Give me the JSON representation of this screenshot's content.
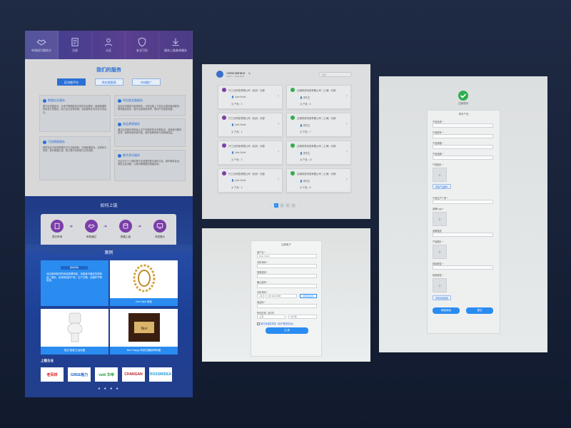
{
  "colors": {
    "accent": "#2a8cf0",
    "brand_purple": "#7b3ea8",
    "success": "#2fae4f",
    "background": "#172238"
  },
  "landing": {
    "nav": [
      {
        "label": "申请成为服务方",
        "icon": "handshake-icon"
      },
      {
        "label": "注册",
        "icon": "document-icon"
      },
      {
        "label": "认证",
        "icon": "user-icon"
      },
      {
        "label": "安全可信",
        "icon": "shield-icon"
      },
      {
        "label": "服务上链查询服务",
        "icon": "download-icon"
      }
    ],
    "services_title": "我们的服务",
    "service_tabs": [
      "区块链平台",
      "供应链管理",
      "市场推广"
    ],
    "service_cards": [
      {
        "title": "数据存证服务",
        "text": "基于区块链技术，为电子数据提供可信的存证服务，确保数据的真实性与完整性，助力企业合规发展，全面保障业务安全可靠运行。"
      },
      {
        "title": "供应链金融服务",
        "text": "结合区块链的可追溯特性，为供应链上下游企业提供融资服务，降低融资成本，提升资金周转效率，推动产业健康发展。"
      },
      {
        "title": "商品溯源服务",
        "text": "通过区块链记录商品从生产到销售的全流程信息，消费者可随时查询，保障商品来源可信，维护品牌形象与消费者权益。"
      },
      {
        "title": "可信数据服务",
        "text": "提供安全可信的数据共享与交换机制，打破数据孤岛，实现多方协同，提升数据价值，助力数字化转型与业务创新。"
      },
      {
        "title": "数字身份服务",
        "text": "为企业与个人提供基于区块链的数字身份认证，保护隐私安全，简化认证流程，让身份管理更加便捷高效。"
      }
    ],
    "how_title": "如何上链",
    "steps": [
      {
        "label": "提交申请",
        "icon": "form-icon"
      },
      {
        "label": "审核通过",
        "icon": "handshake-icon"
      },
      {
        "label": "数据上链",
        "icon": "database-icon"
      },
      {
        "label": "完成展示",
        "icon": "display-icon"
      }
    ],
    "how_button": "我要上链",
    "cases_title": "案例",
    "cases": [
      {
        "label": "",
        "tag": "各地风味",
        "text": "对应各种各样的商品溯源场景，消费者可通过扫描商品二维码，查询商品的产地、生产日期、流通环节等信息。"
      },
      {
        "label": "Gee Mye 珠宝"
      },
      {
        "label": "恒洁 智能卫浴设备"
      },
      {
        "label": "Bee Happy 有机红糖咖啡粉蜜"
      }
    ],
    "cases_highlight_text": "对应各种各样的商品溯源场景，消费者可通过扫描商品二维码，查询商品的产地、生产日期、流通环节等信息。",
    "partners_title": "上链企业",
    "partners": [
      "老凤祥",
      "GREE格力",
      "vatti 华帝",
      "CHANGAN",
      "ROSSMIDEA"
    ],
    "dots": "● ● ● ●"
  },
  "list": {
    "user_name": "Administrator",
    "user_sub": "Admin · 1234 5678",
    "search_placeholder": "搜索",
    "cards": [
      {
        "company": "兴三元科技有限公司（北京）分部",
        "person": "Julie Smith",
        "count": "产品：3",
        "status": "pending"
      },
      {
        "company": "云端商务科技有限公司（上海）分部",
        "person": "黄先生",
        "count": "产品：5",
        "status": "done"
      },
      {
        "company": "兴三元科技有限公司（北京）分部",
        "person": "Julie Smith",
        "count": "产品：3",
        "status": "pending"
      },
      {
        "company": "云端商务科技有限公司（上海）分部",
        "person": "黄先生",
        "count": "产品：7",
        "status": "done"
      },
      {
        "company": "兴三元科技有限公司（北京）分部",
        "person": "Julie Smith",
        "count": "产品：3",
        "status": "pending"
      },
      {
        "company": "云端商务科技有限公司（上海）分部",
        "person": "黄先生",
        "count": "产品：12",
        "status": "done"
      },
      {
        "company": "兴三元科技有限公司（北京）分部",
        "person": "Julie Smith",
        "count": "产品：3",
        "status": "pending"
      },
      {
        "company": "云端商务科技有限公司（上海）分部",
        "person": "黄先生",
        "count": "产品：8",
        "status": "done"
      }
    ],
    "pages": [
      "‹",
      "1",
      "2",
      "3",
      "4",
      "›"
    ]
  },
  "apply": {
    "title": "注册账户",
    "fields": [
      {
        "label": "用户名 *",
        "value": "Julie Smith"
      },
      {
        "label": "手机号码 *",
        "value": ""
      },
      {
        "label": "登录密码 *",
        "value": ""
      },
      {
        "label": "确认密码 *",
        "value": ""
      },
      {
        "label": "手机号码 *",
        "value": ""
      }
    ],
    "phone_prefix": "+86",
    "phone_value": "158 840 8888",
    "code_button": "获取验证码",
    "code_label": "验证码 *",
    "area_label": "所在区域（省/市）",
    "area_values": [
      "上海",
      "长宁区"
    ],
    "agree_text": "我已阅读并同意《用户服务协议》",
    "submit": "注 册"
  },
  "product_form": {
    "success_title": "注册成功",
    "section_title": "填写产品",
    "fields": [
      "产品名称 *",
      "产品型号 *",
      "产品规格 *",
      "产品品牌 *",
      "产品图片 *"
    ],
    "add_image_label": "添加产品图片",
    "after_fields": [
      "产品生产厂家 *",
      "品牌Logo *",
      "品牌描述",
      "产品图片 *",
      "检验报告 *",
      "检验报告 *"
    ],
    "add_label_2": "添加检验报告",
    "btn_left": "继续添加",
    "btn_right": "提交"
  }
}
